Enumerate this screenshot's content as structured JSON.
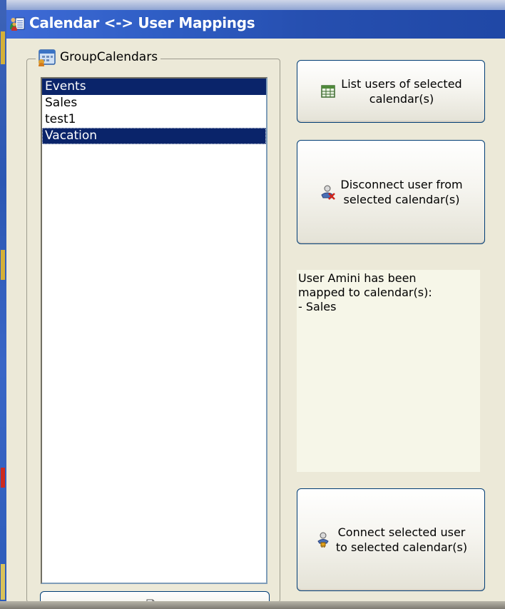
{
  "window": {
    "title": "Calendar <-> User Mappings",
    "title_icon": "calendar-users-icon",
    "titlebar_color": "#2a58bd",
    "face_color": "#ece9d8"
  },
  "groupbox": {
    "label": "GroupCalendars",
    "icon": "group-calendar-icon"
  },
  "calendar_list": {
    "items": [
      {
        "label": "Events",
        "selected": true
      },
      {
        "label": "Sales",
        "selected": false
      },
      {
        "label": "test1",
        "selected": false
      },
      {
        "label": "Vacation",
        "selected": true,
        "focused": true
      }
    ],
    "selection_color": "#0a246a"
  },
  "buttons": {
    "list_users": {
      "line1": "List users of selected",
      "line2": "calendar(s)",
      "icon": "table-grid-icon"
    },
    "disconnect": {
      "line1": "Disconnect user from",
      "line2": "selected calendar(s)",
      "icon": "user-remove-icon"
    },
    "connect": {
      "line1": "Connect selected user",
      "line2": "to selected calendar(s)",
      "icon": "user-connect-icon"
    },
    "bottom": {
      "icon": "document-icon"
    }
  },
  "info_panel": {
    "text": "User Amini has been\nmapped to calendar(s):\n- Sales",
    "background": "#f6f6e8"
  }
}
